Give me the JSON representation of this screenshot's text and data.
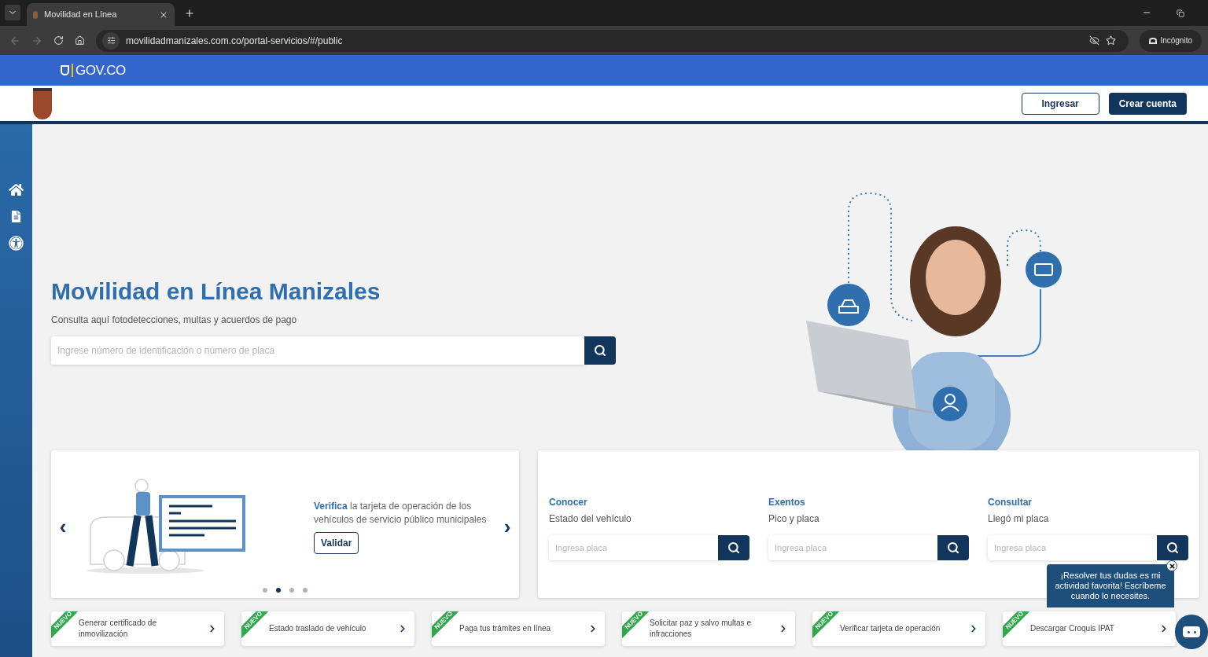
{
  "browser": {
    "tab_title": "Movilidad en Línea",
    "url": "movilidadmanizales.com.co/portal-servicios/#/public",
    "profile_label": "Incógnito"
  },
  "gov_bar": {
    "brand": "GOV.CO"
  },
  "header": {
    "buttons": [
      {
        "label": "Ingresar",
        "kind": "outline"
      },
      {
        "label": "Crear cuenta",
        "kind": "solid"
      }
    ]
  },
  "hero": {
    "title": "Movilidad en Línea Manizales",
    "subtitle": "Consulta aquí fotodetecciones, multas y acuerdos de pago",
    "search": {
      "placeholder": "Ingrese número de identificación o número de placa"
    }
  },
  "carousel": {
    "text": "**Verifica** la tarjeta de operación de los vehículos de servicio público municipales",
    "button": "Validar",
    "prev": "‹",
    "next": "›",
    "dots": [
      {
        "selected": false
      },
      {
        "selected": true
      },
      {
        "selected": false
      },
      {
        "selected": false
      }
    ]
  },
  "queries": [
    {
      "title": "Conocer",
      "subtitle": "Estado del vehículo",
      "placeholder": "Ingresa placa"
    },
    {
      "title": "Exentos",
      "subtitle": "Pico y placa",
      "placeholder": "Ingresa placa"
    },
    {
      "title": "Consultar",
      "subtitle": "Llegó mi placa",
      "placeholder": "Ingresa placa"
    }
  ],
  "chat": {
    "message": "¡Resolver tus dudas es mi actividad favorita! Escríbeme cuando lo necesites."
  },
  "services": [
    {
      "badge": "NUEVO",
      "label": "Generar certificado de inmovilización"
    },
    {
      "badge": "NUEVO",
      "label": "Estado traslado de vehículo"
    },
    {
      "badge": "NUEVO",
      "label": "Paga tus trámites en línea"
    },
    {
      "badge": "NUEVO",
      "label": "Solicitar paz y salvo multas e infracciones"
    },
    {
      "badge": "NUEVO",
      "label": "Verificar tarjeta de operación"
    },
    {
      "badge": "NUEVO",
      "label": "Descargar Croquis IPAT"
    }
  ]
}
